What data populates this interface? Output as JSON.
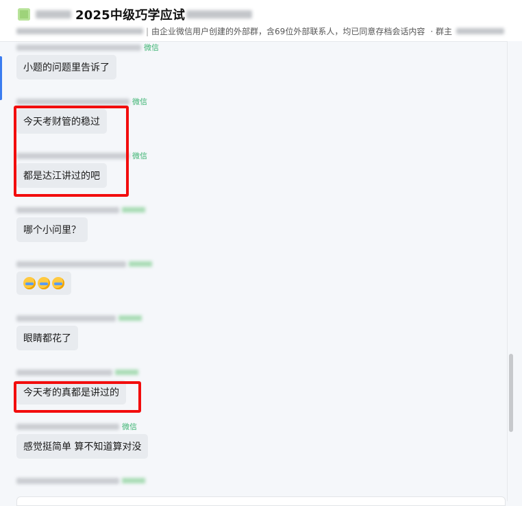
{
  "header": {
    "title": "2025中级巧学应试",
    "description": "由企业微信用户创建的外部群，含69位外部联系人，均已同意存档会话内容",
    "owner_label": "· 群主"
  },
  "messages": [
    {
      "platform": "微信",
      "text": "小题的问题里告诉了"
    },
    {
      "platform": "微信",
      "text": "今天考财管的稳过"
    },
    {
      "platform": "微信",
      "text": "都是达江讲过的吧"
    },
    {
      "platform": "",
      "text": "哪个小问里？"
    },
    {
      "platform": "",
      "text": "",
      "emoji_count": 3
    },
    {
      "platform": "",
      "text": "眼睛都花了"
    },
    {
      "platform": "",
      "text": "今天考的真都是讲过的"
    },
    {
      "platform": "微信",
      "text": "感觉挺简单 算不知道算对没"
    }
  ],
  "colors": {
    "highlight": "#f20d0d",
    "bubble": "#e8ebef",
    "platform": "#3cb371",
    "accent": "#3b7cf0"
  }
}
